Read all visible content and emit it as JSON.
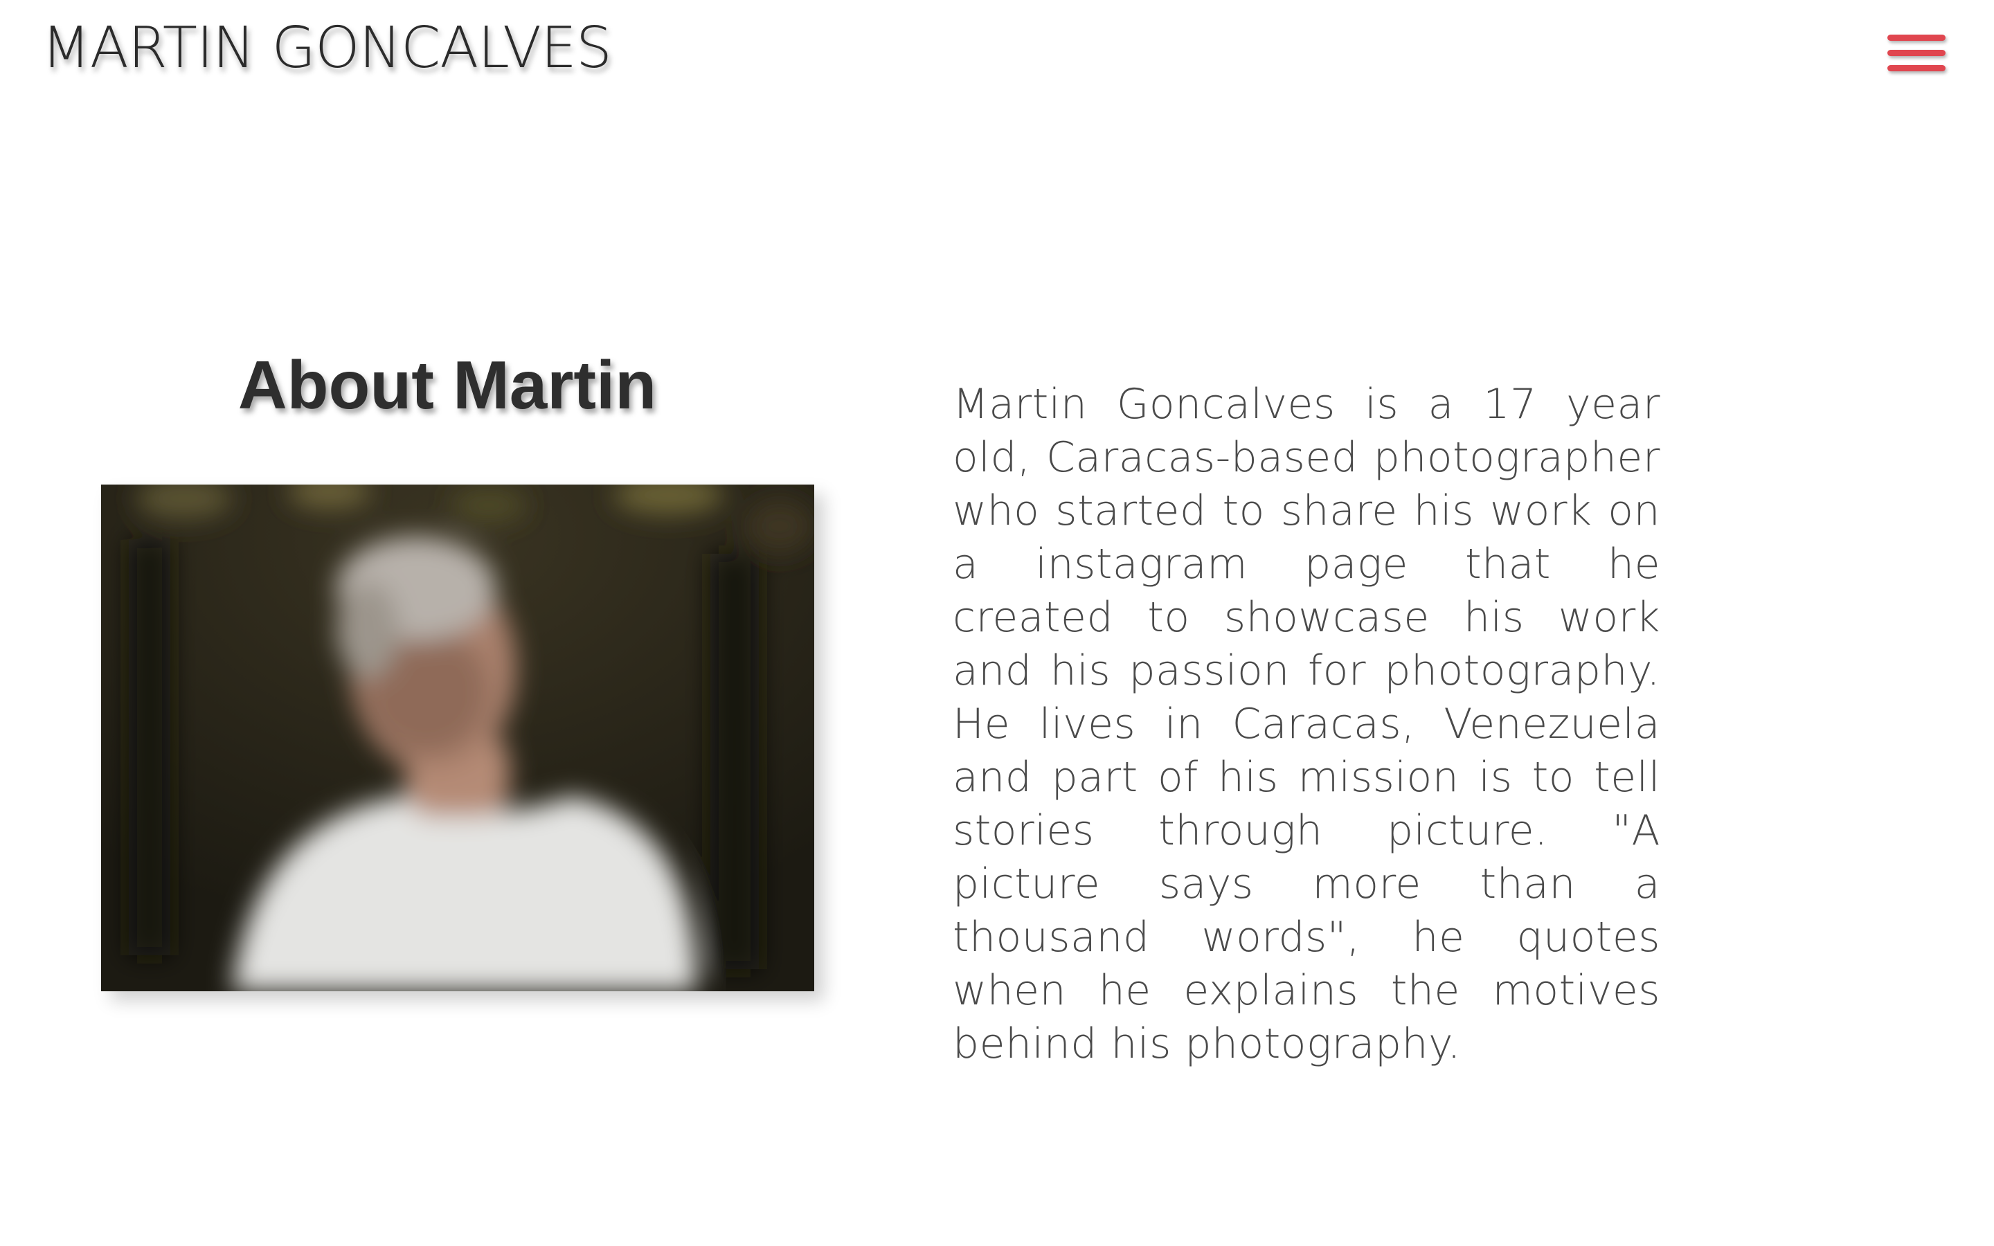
{
  "header": {
    "site_title": "MARTIN GONCALVES",
    "menu_icon": "hamburger-menu-icon",
    "menu_color": "#e0464f"
  },
  "about": {
    "heading": "About Martin",
    "portrait_alt": "Portrait of Martin Goncalves",
    "bio": "Martin Goncalves is a 17 year old, Caracas-based photographer who started to share his work on a instagram page that he created to showcase his work and his passion for photography. He lives in Caracas, Venezuela and part of his mission is to tell stories through picture. \"A picture says more than a thousand words\", he quotes when he explains the motives behind his photography."
  }
}
